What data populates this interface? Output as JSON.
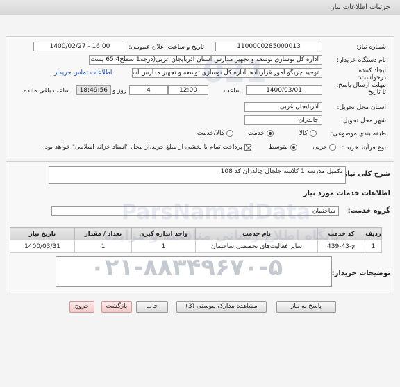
{
  "header": {
    "title": "جزئیات اطلاعات نیاز"
  },
  "form": {
    "need_number_label": "شماره نیاز:",
    "need_number": "1100000285000013",
    "announce_label": "تاریخ و ساعت اعلان عمومی:",
    "announce_value": "1400/02/27 - 16:00",
    "buyer_label": "نام دستگاه خریدار:",
    "buyer_value": "اداره کل نوسازی   توسعه و تجهیز مدارس استان اذربایجان غربی(درجه1  سطح4  65 پست",
    "creator_label": "ایجاد کننده درخواست:",
    "creator_value": "توحید چریگو امور قراردادها اداره کل نوسازی   توسعه و تجهیز مدارس استان اذربا",
    "contact_link": "اطلاعات تماس خریدار",
    "deadline_label": "مهلت ارسال پاسخ: تا تاریخ:",
    "deadline_date": "1400/03/01",
    "time_label": "ساعت",
    "deadline_time": "12:00",
    "days_value": "4",
    "days_label": "روز و",
    "remaining_time": "18:49:56",
    "remaining_label": "ساعت باقی مانده",
    "province_label": "استان محل تحویل:",
    "province_value": "آذربایجان غربی",
    "city_label": "شهر محل تحویل:",
    "city_value": "چالدران",
    "category_label": "طبقه بندی موضوعی:",
    "category_options": [
      "کالا",
      "خدمت",
      "کالا/خدمت"
    ],
    "process_label": "نوع فرآیند خرید :",
    "process_options": [
      "جزیی",
      "متوسط"
    ],
    "payment_note": "پرداخت تمام یا بخشی از مبلغ خرید،از محل \"اسناد خزانه اسلامی\" خواهد بود."
  },
  "summary": {
    "label": "شرح کلی نیاز:",
    "value": "تکمیل مدرسه 1 کلاسه جلجال چالدران کد 108"
  },
  "services": {
    "section_title": "اطلاعات خدمات مورد نیاز",
    "group_label": "گروه خدمت:",
    "group_value": "ساختمان",
    "columns": [
      "ردیف",
      "کد خدمت",
      "نام خدمت",
      "واحد اندازه گیری",
      "تعداد / مقدار",
      "تاریخ نیاز"
    ],
    "rows": [
      [
        "1",
        "ج-43-439",
        "سایر فعالیت‌های تخصصی ساختمان",
        "1",
        "1",
        "1400/03/31"
      ]
    ]
  },
  "buyer_notes": {
    "label": "توضیحات خریدار:",
    "value": ""
  },
  "buttons": {
    "reply": "پاسخ به نیاز",
    "attachments": "مشاهده مدارک پیوستی (3)",
    "print": "چاپ",
    "back": "بازگشت",
    "exit": "خروج"
  },
  "watermark": {
    "brand": "ParsNamadData",
    "tagline": "پایگاه اطلاع رسانی مناقصه و مزایده",
    "phone": "۰۲۱-۸۸۳۴۹۶۷۰-۵",
    "digits": "021"
  }
}
